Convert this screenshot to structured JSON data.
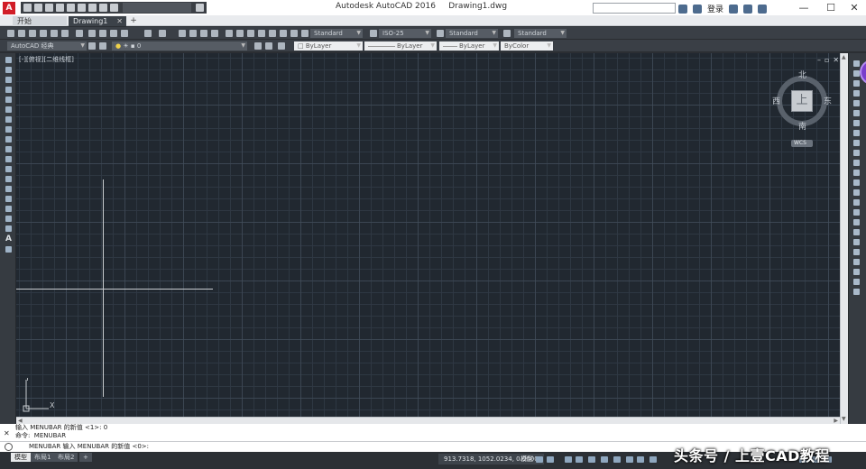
{
  "app": {
    "window_title": "Autodesk AutoCAD 2016     Drawing1.dwg",
    "workspace_label": "",
    "search_placeholder": "",
    "login_label": "登录",
    "minimize": "—",
    "maximize": "☐",
    "close": "✕"
  },
  "tabs": [
    {
      "label": "开始"
    },
    {
      "label": "Drawing1"
    }
  ],
  "tab_add": "+",
  "toolbar": {
    "workspace_combo": "AutoCAD 经典",
    "layer_value": "0",
    "text_style": "Standard",
    "dim_style": "ISO-25",
    "table_style": "Standard",
    "mleader_style": "Standard",
    "color": "ByLayer",
    "linetype": "ByLayer",
    "lineweight": "ByLayer",
    "plotstyle": "ByColor"
  },
  "canvas": {
    "view_label": "[-][俯视][二维线框]",
    "viewcube": {
      "top": "上",
      "north": "北",
      "south": "南",
      "east": "东",
      "west": "西"
    },
    "wcs_label": "WCS",
    "ucs_y": "Y",
    "ucs_x": "X"
  },
  "command": {
    "history": [
      "输入 MENUBAR 的新值 <1>: 0",
      "命令:  MENUBAR"
    ],
    "prompt": "MENUBAR 输入 MENUBAR 的新值 <0>:"
  },
  "status": {
    "layout_tabs": [
      "模型",
      "布局1",
      "布局2"
    ],
    "coords": "913.7318, 1052.0234, 0.0000",
    "model": "模型"
  },
  "watermark": "头条号 / 上壹CAD教程"
}
